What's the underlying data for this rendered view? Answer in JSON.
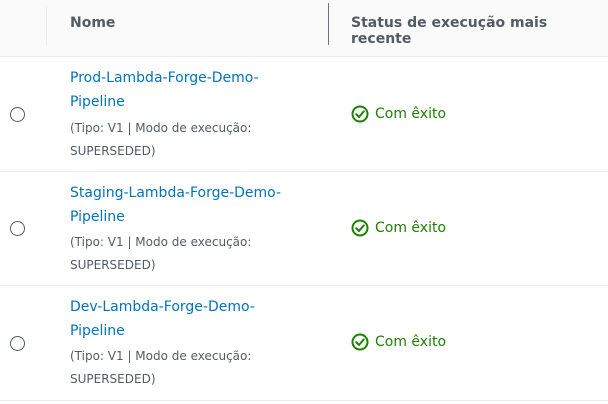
{
  "header": {
    "name_label": "Nome",
    "status_label": "Status de execução mais recente"
  },
  "rows": [
    {
      "name": "Prod-Lambda-Forge-Demo-Pipeline",
      "meta": "(Tipo: V1 | Modo de execução: SUPERSEDED)",
      "status": "Com êxito"
    },
    {
      "name": "Staging-Lambda-Forge-Demo-Pipeline",
      "meta": "(Tipo: V1 | Modo de execução: SUPERSEDED)",
      "status": "Com êxito"
    },
    {
      "name": "Dev-Lambda-Forge-Demo-Pipeline",
      "meta": "(Tipo: V1 | Modo de execução: SUPERSEDED)",
      "status": "Com êxito"
    }
  ],
  "colors": {
    "link": "#0073bb",
    "success": "#1d8102",
    "header_bg": "#fafafa"
  },
  "icons": {
    "status": "check-circle-icon",
    "select": "radio-button"
  }
}
